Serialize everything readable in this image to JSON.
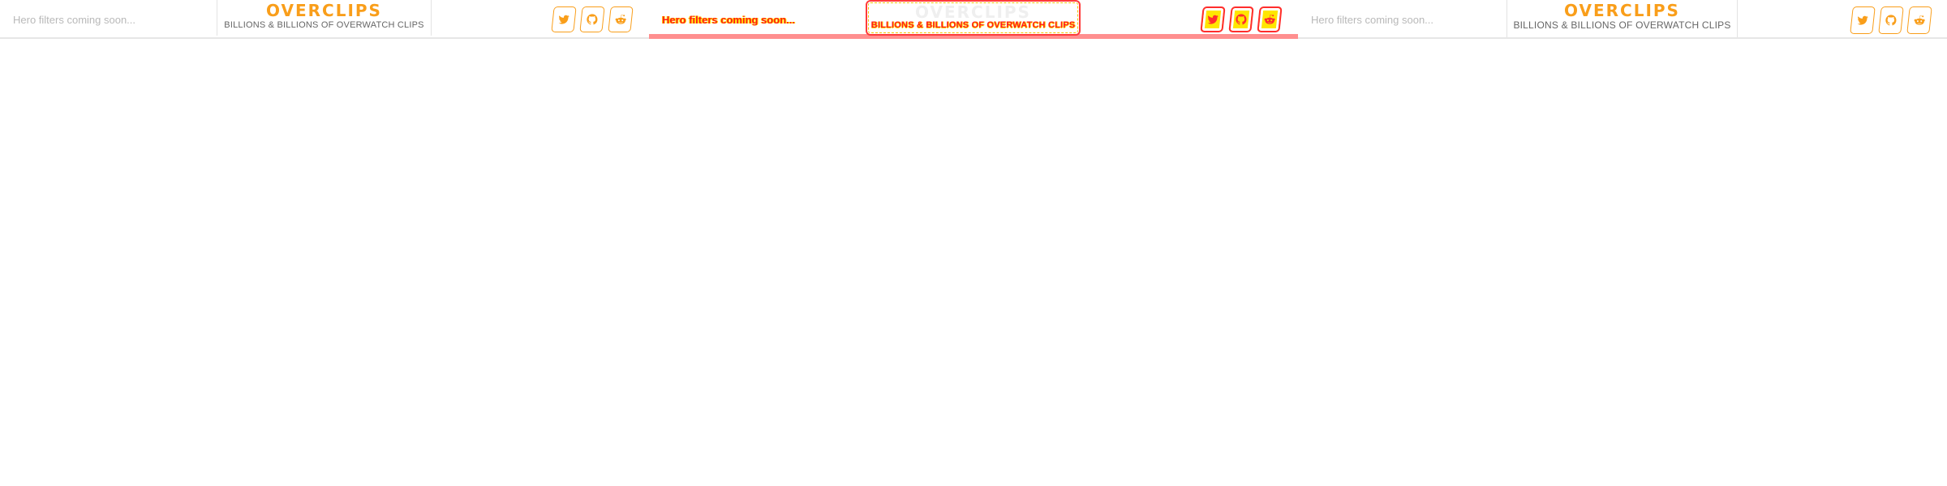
{
  "header": {
    "search": {
      "placeholder": "Hero filters coming soon..."
    },
    "logo": "OVERCLIPS",
    "tagline": "BILLIONS & BILLIONS OF OVERWATCH CLIPS",
    "socials": [
      {
        "name": "Twitter",
        "icon": "twitter-icon"
      },
      {
        "name": "GitHub",
        "icon": "github-icon"
      },
      {
        "name": "Reddit",
        "icon": "reddit-icon"
      }
    ]
  },
  "colors": {
    "accent": "#f99e1a",
    "tagline": "#666666",
    "placeholder": "#b9b9b9",
    "debug_red": "#ff3b3b",
    "debug_yellow": "#ffe600"
  }
}
